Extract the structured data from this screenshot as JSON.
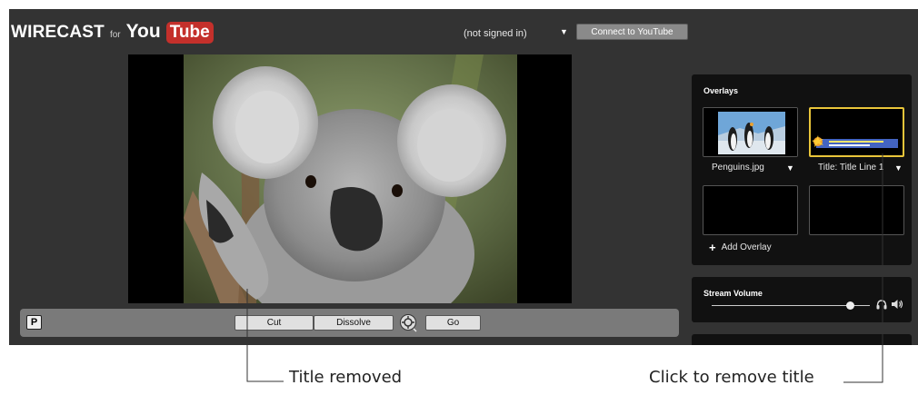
{
  "app": {
    "logo_text": "WIRECAST",
    "logo_for": "for",
    "logo_you": "You",
    "logo_tube": "Tube"
  },
  "header": {
    "signin_status": "(not signed in)",
    "signin_dropdown_icon": "triangle-down",
    "connect_label": "Connect to YouTube"
  },
  "preview": {
    "image_subject": "koala photo"
  },
  "controls": {
    "p_label": "P",
    "cut_label": "Cut",
    "dissolve_label": "Dissolve",
    "go_label": "Go",
    "transition_icon": "transition-speed-icon"
  },
  "overlays": {
    "title": "Overlays",
    "items": [
      {
        "label": "Penguins.jpg",
        "thumb": "penguins photo"
      },
      {
        "label": "Title: Title Line 1",
        "thumb": "title overlay",
        "selected_color": "#e9c53a"
      }
    ],
    "add_label": "Add Overlay"
  },
  "stream_volume": {
    "title": "Stream Volume",
    "level": 0.9
  },
  "annotations": {
    "left": "Title removed",
    "right": "Click to remove title"
  }
}
